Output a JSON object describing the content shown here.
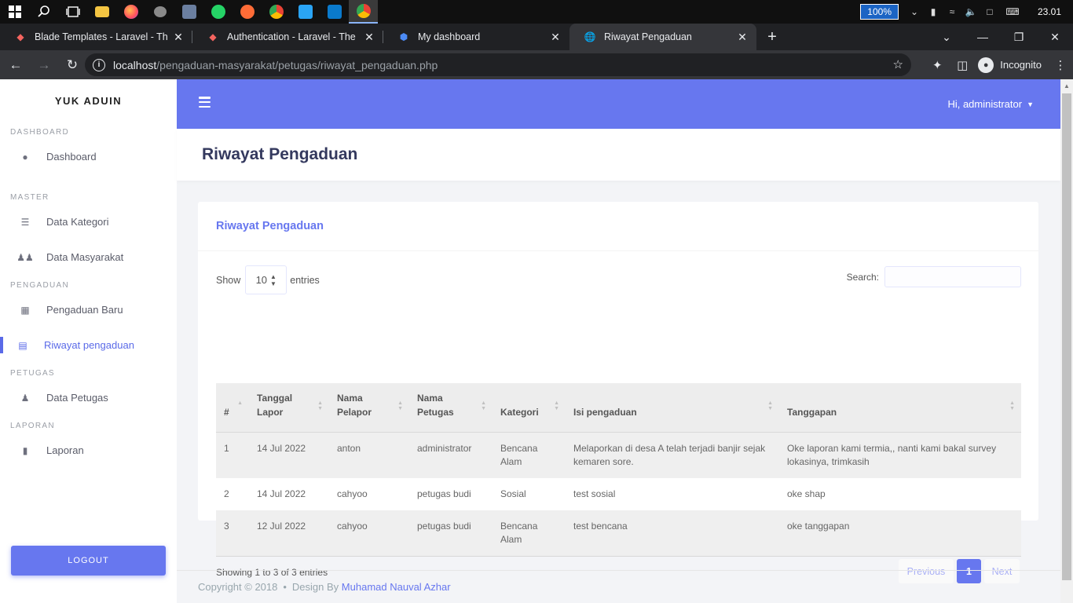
{
  "taskbar": {
    "zoom": "100%",
    "clock": "23.01",
    "icons": [
      "windows-start-icon",
      "search-icon",
      "task-view-icon",
      "file-explorer-icon",
      "firefox-icon",
      "app-icon",
      "photos-icon",
      "whatsapp-icon",
      "postman-icon",
      "chrome-icon",
      "app-store-icon",
      "vscode-icon",
      "chrome-active-icon"
    ]
  },
  "browser": {
    "tabs": [
      {
        "title": "Blade Templates - Laravel - The PHP",
        "favicon": "laravel-icon"
      },
      {
        "title": "Authentication - Laravel - The PHP",
        "favicon": "laravel-icon"
      },
      {
        "title": "My dashboard",
        "favicon": "shield-icon"
      },
      {
        "title": "Riwayat Pengaduan",
        "favicon": "globe-icon"
      }
    ],
    "url_host": "localhost",
    "url_path": "/pengaduan-masyarakat/petugas/riwayat_pengaduan.php",
    "incognito_label": "Incognito"
  },
  "sidebar": {
    "brand": "YUK ADUIN",
    "sections": {
      "dashboard": "DASHBOARD",
      "master": "MASTER",
      "pengaduan": "PENGADUAN",
      "petugas": "PETUGAS",
      "laporan": "LAPORAN"
    },
    "items": {
      "dashboard": "Dashboard",
      "kategori": "Data Kategori",
      "masyarakat": "Data Masyarakat",
      "pengaduan_baru": "Pengaduan Baru",
      "riwayat": "Riwayat pengaduan",
      "petugas": "Data Petugas",
      "laporan": "Laporan"
    },
    "logout": "LOGOUT"
  },
  "topnav": {
    "greeting": "Hi, administrator"
  },
  "page": {
    "title": "Riwayat Pengaduan"
  },
  "card": {
    "title": "Riwayat Pengaduan",
    "show_label": "Show",
    "page_size": "10",
    "entries_label": "entries",
    "search_label": "Search:",
    "search_value": ""
  },
  "table": {
    "columns": [
      "#",
      "Tanggal Lapor",
      "Nama Pelapor",
      "Nama Petugas",
      "Kategori",
      "Isi pengaduan",
      "Tanggapan"
    ],
    "rows": [
      [
        "1",
        "14 Jul 2022",
        "anton",
        "administrator",
        "Bencana Alam",
        "Melaporkan di desa A telah terjadi banjir sejak kemaren sore.",
        "Oke laporan kami termia,, nanti kami bakal survey lokasinya, trimkasih"
      ],
      [
        "2",
        "14 Jul 2022",
        "cahyoo",
        "petugas budi",
        "Sosial",
        "test sosial",
        "oke shap"
      ],
      [
        "3",
        "12 Jul 2022",
        "cahyoo",
        "petugas budi",
        "Bencana Alam",
        "test bencana",
        "oke tanggapan"
      ]
    ]
  },
  "pagination": {
    "info": "Showing 1 to 3 of 3 entries",
    "previous": "Previous",
    "current": "1",
    "next": "Next"
  },
  "footer": {
    "copyright": "Copyright © 2018",
    "design_by": "Design By",
    "author": "Muhamad Nauval Azhar"
  },
  "colors": {
    "primary": "#6777ef",
    "title": "#34395e"
  }
}
